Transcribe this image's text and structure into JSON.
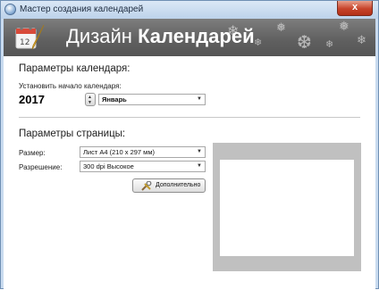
{
  "window": {
    "title": "Мастер создания календарей",
    "close_label": "x"
  },
  "banner": {
    "title_light": "Дизайн",
    "title_bold": "Календарей"
  },
  "calendar_params": {
    "heading": "Параметры календаря:",
    "start_label": "Установить начало календаря:",
    "year": "2017",
    "month": "Январь"
  },
  "page_params": {
    "heading": "Параметры страницы:",
    "size_label": "Размер:",
    "size_value": "Лист A4 (210 x 297 мм)",
    "resolution_label": "Разрешение:",
    "resolution_value": "300 dpi Высокое",
    "advanced_button": "Дополнительно"
  }
}
